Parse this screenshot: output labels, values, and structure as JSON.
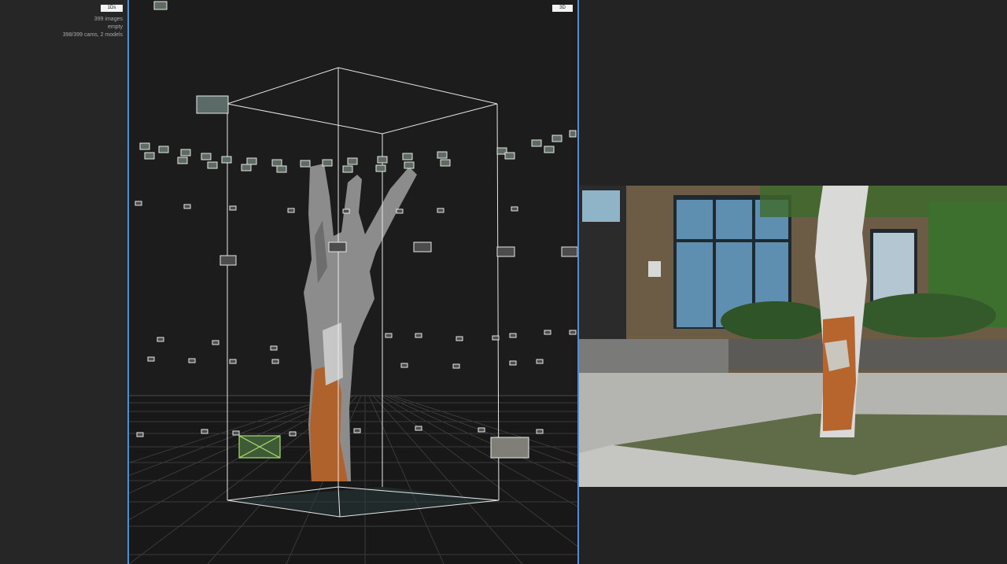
{
  "sidebar": {
    "ds_label": "1Ds",
    "stats": {
      "images": "399 images",
      "state": "empty",
      "cameras": "398/399 cams, 2 models"
    }
  },
  "viewport": {
    "mode_label": "3D",
    "colors": {
      "background": "#1c1c1d",
      "border": "#4a90e2",
      "selected_camera": "#a8e36b",
      "bbox": "#e8e8e8"
    }
  },
  "image_viewer": {
    "photo_icon": "tree-photo"
  }
}
